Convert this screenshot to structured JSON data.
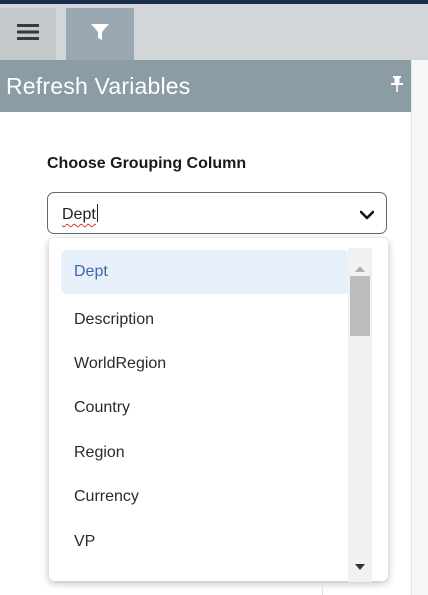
{
  "panel": {
    "title": "Refresh Variables"
  },
  "grouping": {
    "label": "Choose Grouping Column",
    "value": "Dept"
  },
  "dropdown": {
    "options": [
      "Dept",
      "Description",
      "WorldRegion",
      "Country",
      "Region",
      "Currency",
      "VP"
    ],
    "selected": "Dept"
  },
  "icons": {
    "toolbar": [
      "hamburger-menu-icon",
      "filter-icon"
    ],
    "panel": [
      "pin-icon"
    ],
    "select": [
      "chevron-down-icon"
    ],
    "scrollbar": [
      "arrow-up-icon",
      "arrow-down-icon"
    ]
  },
  "colors": {
    "toolbar_bg": "#d3d6d9",
    "active_tab": "#9aa8b1",
    "panel_header": "#8c9ca5",
    "selected_option_bg": "#e8f1fb",
    "selected_option_text": "#3a6aa6"
  }
}
